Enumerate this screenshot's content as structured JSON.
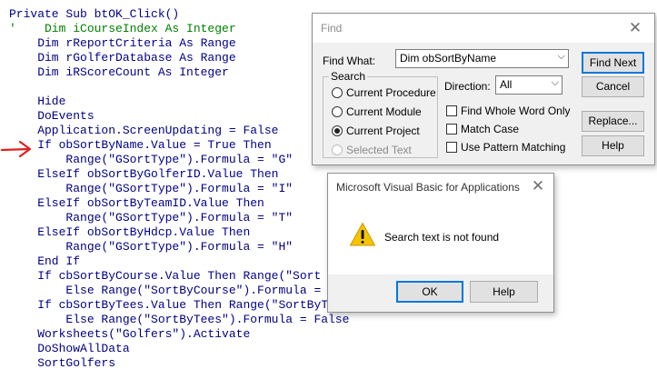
{
  "code_lines": [
    {
      "parts": [
        {
          "t": "Private Sub btOK_Click()",
          "c": "kw"
        }
      ]
    },
    {
      "parts": [
        {
          "t": "'    Dim iCourseIndex As Integer",
          "c": "cm"
        }
      ]
    },
    {
      "parts": [
        {
          "t": "    Dim rReportCriteria As Range",
          "c": "kw"
        }
      ]
    },
    {
      "parts": [
        {
          "t": "    Dim rGolferDatabase As Range",
          "c": "kw"
        }
      ]
    },
    {
      "parts": [
        {
          "t": "    Dim iRScoreCount As Integer",
          "c": "kw"
        }
      ]
    },
    {
      "parts": [
        {
          "t": "",
          "c": ""
        }
      ]
    },
    {
      "parts": [
        {
          "t": "    Hide",
          "c": ""
        }
      ]
    },
    {
      "parts": [
        {
          "t": "    DoEvents",
          "c": ""
        }
      ]
    },
    {
      "parts": [
        {
          "t": "    Application.ScreenUpdating = False",
          "c": ""
        }
      ]
    },
    {
      "parts": [
        {
          "t": "    If obSortByName.Value = True Then",
          "c": "kw"
        }
      ]
    },
    {
      "parts": [
        {
          "t": "        Range(\"GSortType\").Formula = \"G\"",
          "c": ""
        }
      ]
    },
    {
      "parts": [
        {
          "t": "    ElseIf obSortByGolferID.Value Then",
          "c": "kw"
        }
      ]
    },
    {
      "parts": [
        {
          "t": "        Range(\"GSortType\").Formula = \"I\"",
          "c": ""
        }
      ]
    },
    {
      "parts": [
        {
          "t": "    ElseIf obSortByTeamID.Value Then",
          "c": "kw"
        }
      ]
    },
    {
      "parts": [
        {
          "t": "        Range(\"GSortType\").Formula = \"T\"",
          "c": ""
        }
      ]
    },
    {
      "parts": [
        {
          "t": "    ElseIf obSortByHdcp.Value Then",
          "c": "kw"
        }
      ]
    },
    {
      "parts": [
        {
          "t": "        Range(\"GSortType\").Formula = \"H\"",
          "c": ""
        }
      ]
    },
    {
      "parts": [
        {
          "t": "    End If",
          "c": "kw"
        }
      ]
    },
    {
      "parts": [
        {
          "t": "    If cbSortByCourse.Value Then Range(\"Sort",
          "c": "kw"
        }
      ]
    },
    {
      "parts": [
        {
          "t": "        Else Range(\"SortByCourse\").Formula =",
          "c": ""
        }
      ]
    },
    {
      "parts": [
        {
          "t": "    If cbSortByTees.Value Then Range(\"SortByTees\").Formula = True _",
          "c": "kw"
        }
      ]
    },
    {
      "parts": [
        {
          "t": "        Else Range(\"SortByTees\").Formula = False",
          "c": ""
        }
      ]
    },
    {
      "parts": [
        {
          "t": "    Worksheets(\"Golfers\").Activate",
          "c": ""
        }
      ]
    },
    {
      "parts": [
        {
          "t": "    DoShowAllData",
          "c": ""
        }
      ]
    },
    {
      "parts": [
        {
          "t": "    SortGolfers",
          "c": ""
        }
      ]
    }
  ],
  "find_dialog": {
    "title": "Find",
    "close_glyph": "✕",
    "find_what_label": "Find What:",
    "find_what_value": "Dim obSortByName",
    "search_group_label": "Search",
    "search_options": [
      {
        "label": "Current Procedure",
        "selected": false,
        "disabled": false
      },
      {
        "label": "Current Module",
        "selected": false,
        "disabled": false
      },
      {
        "label": "Current Project",
        "selected": true,
        "disabled": false
      },
      {
        "label": "Selected Text",
        "selected": false,
        "disabled": true
      }
    ],
    "direction_label": "Direction:",
    "direction_value": "All",
    "checkboxes": [
      {
        "label": "Find Whole Word Only",
        "checked": false
      },
      {
        "label": "Match Case",
        "checked": false
      },
      {
        "label": "Use Pattern Matching",
        "checked": false
      }
    ],
    "buttons": {
      "find_next": "Find Next",
      "cancel": "Cancel",
      "replace": "Replace...",
      "help": "Help"
    }
  },
  "message_box": {
    "title": "Microsoft Visual Basic for Applications",
    "close_glyph": "✕",
    "message": "Search text is not found",
    "icon": "warning-icon",
    "ok_label": "OK",
    "help_label": "Help"
  },
  "colors": {
    "keyword": "#00008b",
    "comment": "#008000",
    "arrow": "#e02020",
    "default_button_border": "#0078d7"
  }
}
